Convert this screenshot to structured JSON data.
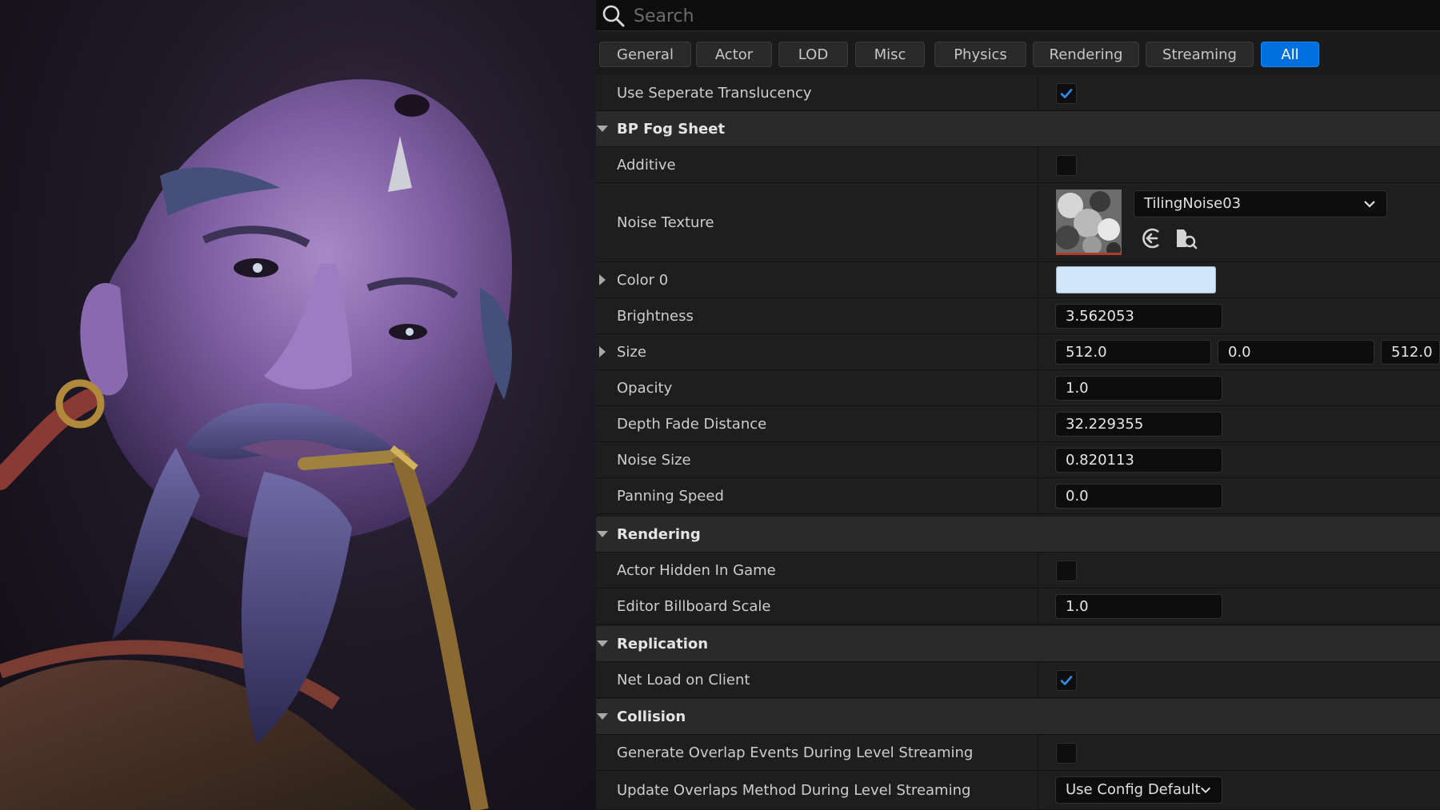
{
  "search": {
    "placeholder": "Search",
    "value": ""
  },
  "tabs": [
    {
      "label": "General"
    },
    {
      "label": "Actor"
    },
    {
      "label": "LOD"
    },
    {
      "label": "Misc"
    },
    {
      "label": "Physics"
    },
    {
      "label": "Rendering"
    },
    {
      "label": "Streaming"
    },
    {
      "label": "All"
    }
  ],
  "active_tab": "All",
  "rows": {
    "use_separate_translucency": {
      "label": "Use Seperate Translucency",
      "checked": true
    },
    "bp_fog_sheet": {
      "label": "BP Fog Sheet",
      "expanded": true
    },
    "additive": {
      "label": "Additive",
      "checked": false
    },
    "noise_texture": {
      "label": "Noise Texture",
      "asset": "TilingNoise03"
    },
    "color0": {
      "label": "Color 0",
      "color": "#d2e6fb"
    },
    "brightness": {
      "label": "Brightness",
      "value": "3.562053"
    },
    "size": {
      "label": "Size",
      "x": "512.0",
      "y": "0.0",
      "z": "512.0"
    },
    "opacity": {
      "label": "Opacity",
      "value": "1.0"
    },
    "depth_fade_distance": {
      "label": "Depth Fade Distance",
      "value": "32.229355"
    },
    "noise_size": {
      "label": "Noise Size",
      "value": "0.820113"
    },
    "panning_speed": {
      "label": "Panning Speed",
      "value": "0.0"
    },
    "rendering": {
      "label": "Rendering",
      "expanded": true
    },
    "actor_hidden_in_game": {
      "label": "Actor Hidden In Game",
      "checked": false
    },
    "editor_billboard_scale": {
      "label": "Editor Billboard Scale",
      "value": "1.0"
    },
    "replication": {
      "label": "Replication",
      "expanded": true
    },
    "net_load_on_client": {
      "label": "Net Load on Client",
      "checked": true
    },
    "collision": {
      "label": "Collision",
      "expanded": true
    },
    "generate_overlap_events": {
      "label": "Generate Overlap Events During Level Streaming",
      "checked": false
    },
    "update_overlaps_method": {
      "label": "Update Overlaps Method During Level Streaming",
      "value": "Use Config Default"
    }
  },
  "colors": {
    "accent": "#0070e0",
    "checkmark": "#2f8cf0",
    "panel_bg": "#1a1a1a",
    "row_bg": "#1e1e1e",
    "category_bg": "#2a2a2a",
    "texture_underline": "#b23a2c"
  },
  "icons": {
    "search": "search-icon",
    "expand": "triangle-down-icon",
    "collapse": "triangle-right-icon",
    "check": "checkmark-icon",
    "dropdown": "chevron-down-icon",
    "use_selected": "arrow-left-circle-icon",
    "browse": "browse-asset-icon"
  }
}
